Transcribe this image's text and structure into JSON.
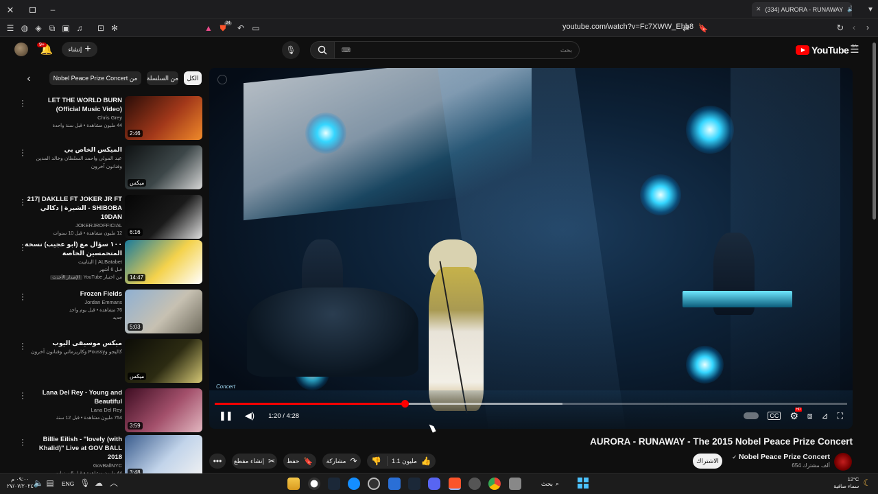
{
  "browser": {
    "tab_title": "(334) AURORA - RUNAWAY",
    "url": "youtube.com/watch?v=Fc7XWW_Ehb8",
    "shield_count": "24"
  },
  "header": {
    "logo_text": "YouTube",
    "logo_region": "SA",
    "search_placeholder": "بحث",
    "create_label": "إنشاء",
    "notification_count": "9+"
  },
  "playlist": {
    "chip_all": "الكل",
    "chip_series": "من السلسلة",
    "chip_concert": "Nobel Peace Prize Concert من"
  },
  "sidebar": {
    "items": [
      {
        "title": "LET THE WORLD BURN (Official Music Video)",
        "channel": "Chris Grey",
        "views": "44 مليون مشاهدة • قبل سنة واحدة",
        "duration": "2:46",
        "colors": [
          "#2a0d08",
          "#a2381a",
          "#f08a2a"
        ]
      },
      {
        "title": "الميكس الخاص بي",
        "channel": "عبد المولى واحمد السلطان وخالد المدين وفنانون آخرون",
        "views": "",
        "duration": "ميكس",
        "colors": [
          "#0e1112",
          "#3d4749",
          "#d6d6d6"
        ]
      },
      {
        "title": "217| DAKLLE FT JOKER JR FT الشيرة | دكالي - SHIBOBA 10DAN",
        "channel": "JOKERJROFFICIAL",
        "views": "12 مليون مشاهدة • قبل 10 سنوات",
        "duration": "6:16",
        "colors": [
          "#050505",
          "#1a1a1a",
          "#e0e0e0"
        ]
      },
      {
        "title": "١٠٠ سؤال مع (ابو عجيب) نسخة المتحمسين الخاصة",
        "channel": "ALBatabet | البتابيت",
        "views": "قبل 6 أشهر",
        "extra": "من اختيار YouTube",
        "extra_badge": "الإصدار الأحدث",
        "duration": "14:47",
        "colors": [
          "#1a7b9c",
          "#f4d24c",
          "#ffffff"
        ]
      },
      {
        "title": "Frozen Fields",
        "channel": "Jordan Emmans",
        "views": "76 مشاهدة • قبل يوم واحد",
        "extra": "جديد",
        "duration": "5:03",
        "colors": [
          "#8fb0d2",
          "#c7c1b2",
          "#6e6a5c"
        ]
      },
      {
        "title": "ميكس موسيقى اليوب",
        "channel": "كاليجو وPoussy وكاريزماتي وفنانون آخرون",
        "views": "",
        "duration": "ميكس",
        "colors": [
          "#0c0c07",
          "#2c2b12",
          "#d5c875"
        ]
      },
      {
        "title": "Lana Del Rey - Young and Beautiful",
        "channel": "Lana Del Rey",
        "views": "754 مليون مشاهدة • قبل 12 سنة",
        "duration": "3:59",
        "colors": [
          "#3e0d22",
          "#a3506b",
          "#e2b7c0"
        ]
      },
      {
        "title": "Billie Eilish - \"lovely (with Khalid)\" Live at GOV BALL 2018",
        "channel": "GovBallNYC",
        "views": "44 مليون مشاهدة • قبل 6 سنوات",
        "duration": "3:48",
        "colors": [
          "#3a5c8d",
          "#c2d4ea",
          "#f2f2f2"
        ]
      }
    ]
  },
  "player": {
    "time": "1:20 / 4:28",
    "played_fraction": 0.3,
    "loaded_fraction": 0.55,
    "hd_badge": "HD",
    "watermark": "Concert"
  },
  "video": {
    "title": "AURORA - RUNAWAY - The 2015 Nobel Peace Prize Concert",
    "channel": "Nobel Peace Prize Concert",
    "subscribers": "654 ألف مشترك",
    "subscribe_label": "الاشتراك",
    "like_count": "1.1 مليون",
    "share_label": "مشاركة",
    "save_label": "حفظ",
    "clip_label": "إنشاء مقطع"
  },
  "taskbar": {
    "search_label": "بحث",
    "lang": "ENG",
    "time": "٠٩:٠٠ م",
    "date": "٢٧/٠٧/٢٠٢٤",
    "weather_temp": "12°C",
    "weather_desc": "سماء صافية"
  }
}
